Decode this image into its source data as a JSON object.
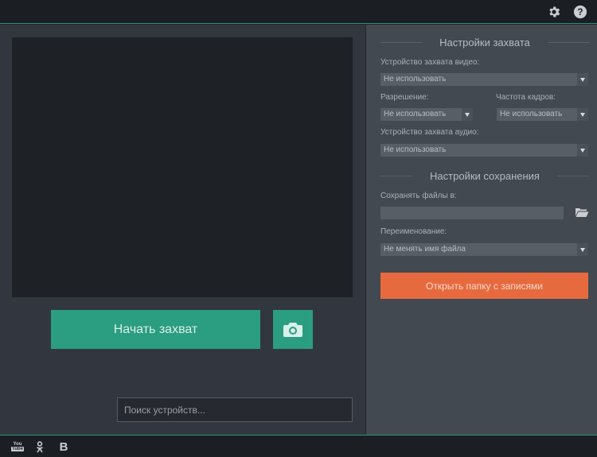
{
  "topbar": {
    "settings_icon": "gear-icon",
    "help_icon": "help-icon",
    "help_glyph": "?"
  },
  "left": {
    "start_label": "Начать захват",
    "snapshot_icon": "camera-icon",
    "search_placeholder": "Поиск устройств..."
  },
  "capture_settings": {
    "title": "Настройки захвата",
    "video_device_label": "Устройство захвата видео:",
    "video_device_value": "Не использовать",
    "resolution_label": "Разрешение:",
    "resolution_value": "Не использовать",
    "framerate_label": "Частота кадров:",
    "framerate_value": "Не использовать",
    "audio_device_label": "Устройство захвата аудио:",
    "audio_device_value": "Не использовать"
  },
  "save_settings": {
    "title": "Настройки сохранения",
    "save_to_label": "Сохранять файлы в:",
    "save_to_value": "",
    "folder_icon": "folder-open-icon",
    "rename_label": "Переименование:",
    "rename_value": "Не менять имя файла",
    "open_folder_label": "Открыть папку с записями"
  },
  "footer": {
    "youtube_top": "You",
    "youtube_bottom": "Tube",
    "ok_glyph": "ꝋ",
    "vk_glyph": "B"
  },
  "colors": {
    "accent_green": "#2b9d81",
    "accent_orange": "#e76a3f",
    "panel_dark": "#32373f",
    "panel_light": "#434950"
  }
}
